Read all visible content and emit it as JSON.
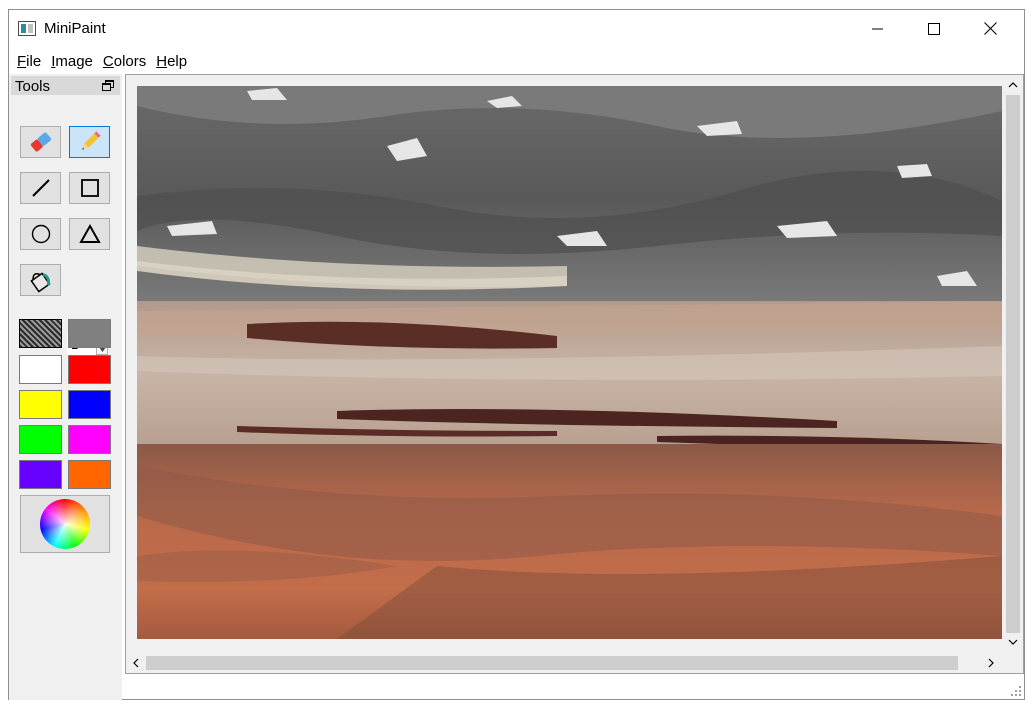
{
  "window": {
    "title": "MiniPaint",
    "app_icon": "minipaint-app-icon",
    "controls": [
      "minimize-icon",
      "maximize-icon",
      "close-icon"
    ]
  },
  "menu": {
    "items": [
      {
        "label": "File"
      },
      {
        "label": "Image"
      },
      {
        "label": "Colors"
      },
      {
        "label": "Help"
      }
    ]
  },
  "tools_panel": {
    "title": "Tools",
    "float_icon": "restore-window-icon",
    "tools": [
      {
        "name": "eraser",
        "icon": "eraser-icon",
        "active": false
      },
      {
        "name": "pencil",
        "icon": "pencil-icon",
        "active": true
      },
      {
        "name": "line",
        "icon": "line-icon",
        "active": false
      },
      {
        "name": "rectangle",
        "icon": "rectangle-icon",
        "active": false
      },
      {
        "name": "ellipse",
        "icon": "circle-icon",
        "active": false
      },
      {
        "name": "triangle",
        "icon": "triangle-icon",
        "active": false
      },
      {
        "name": "fill",
        "icon": "paint-bucket-icon",
        "active": false
      }
    ],
    "brush_size": "1",
    "palette": {
      "primary": "#2b2b2b",
      "secondary": "#808080",
      "colors": [
        "#ffffff",
        "#ff0000",
        "#ffff00",
        "#0000ff",
        "#00ff00",
        "#ff00ff",
        "#6600ff",
        "#ff6600"
      ]
    },
    "color_picker_icon": "color-wheel-icon"
  },
  "canvas": {
    "image": "martian-landscape-photo"
  },
  "colors": {
    "window_bg": "#ffffff",
    "panel_bg": "#f0f0f0",
    "active_tool_bg": "#cce4f7",
    "active_tool_border": "#0078d7"
  }
}
